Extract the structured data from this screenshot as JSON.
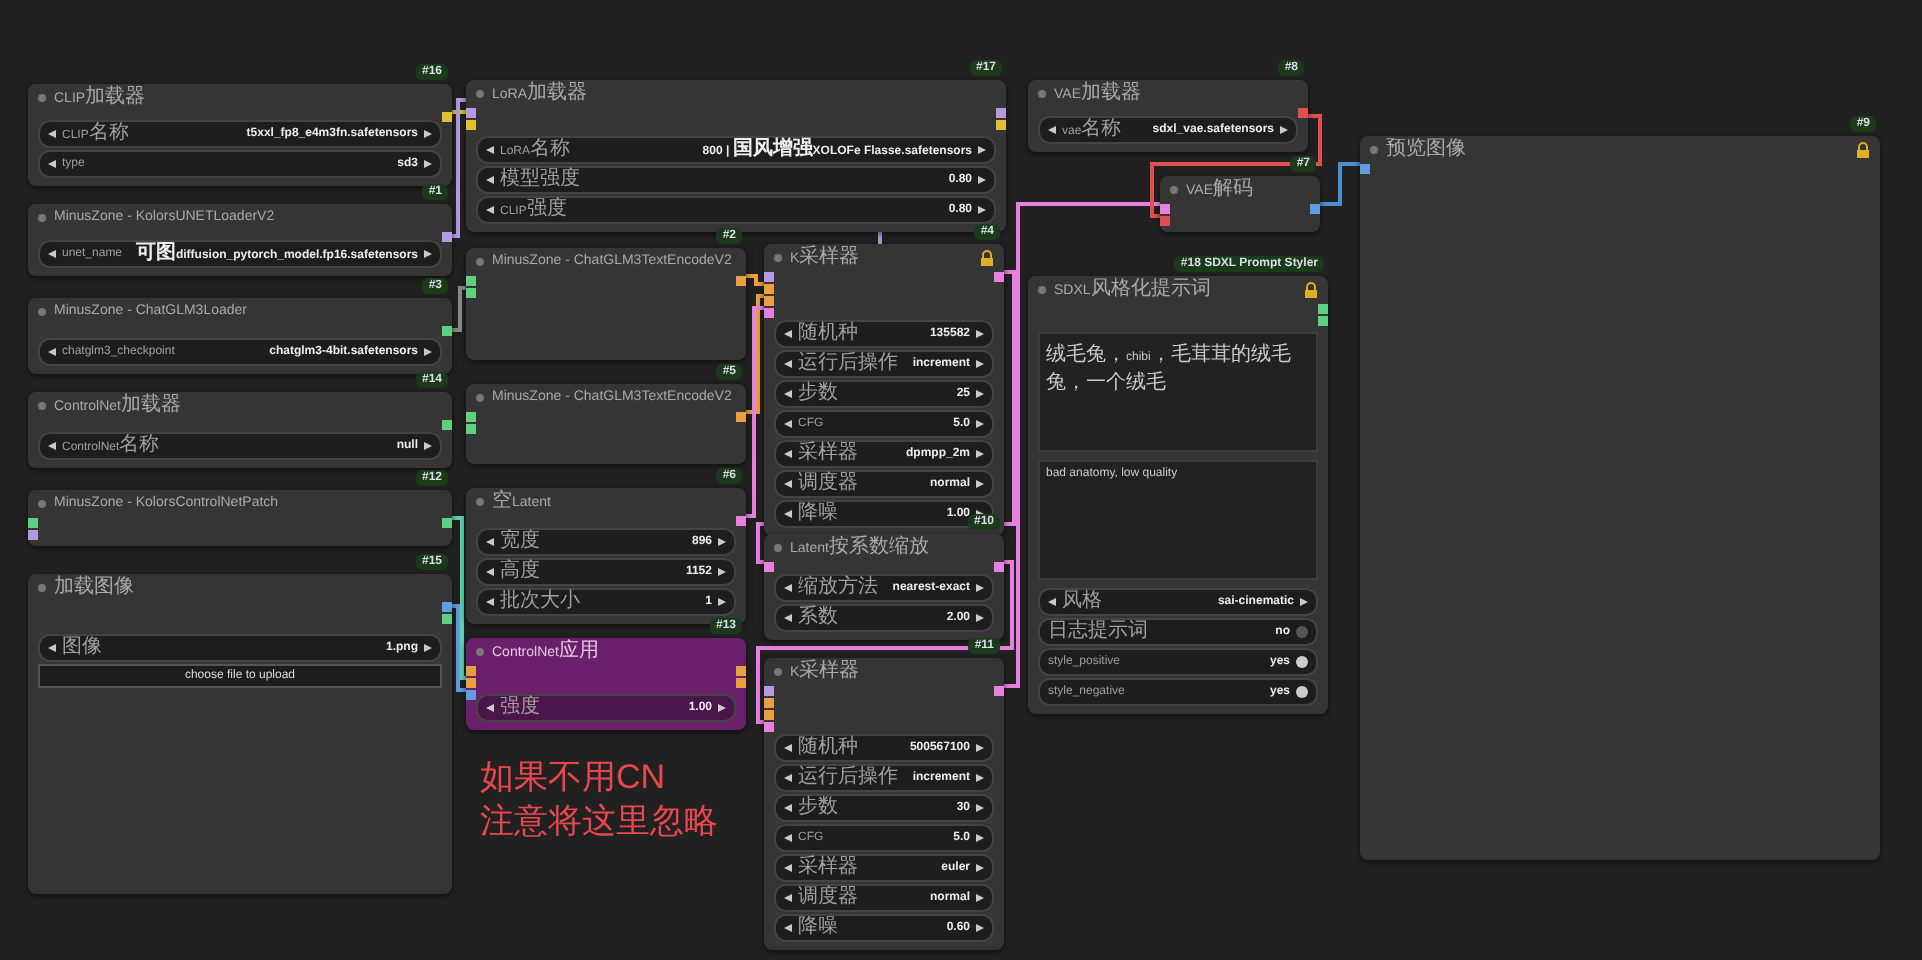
{
  "nodes": [
    {
      "badge": "#16",
      "title": "CLIP加载器",
      "bypassed": false,
      "locked": false,
      "widgets": [
        {
          "kind": "combo",
          "label": "CLIP名称",
          "value": "t5xxl_fp8_e4m3fn.safetensors"
        },
        {
          "kind": "combo",
          "label": "type",
          "value": "sd3"
        }
      ]
    },
    {
      "badge": "#1",
      "title": "MinusZone - KolorsUNETLoaderV2",
      "bypassed": false,
      "locked": false,
      "widgets": [
        {
          "kind": "combo",
          "label": "unet_name",
          "value": "可图diffusion_pytorch_model.fp16.safetensors"
        }
      ]
    },
    {
      "badge": "#3",
      "title": "MinusZone - ChatGLM3Loader",
      "bypassed": false,
      "locked": false,
      "widgets": [
        {
          "kind": "combo",
          "label": "chatglm3_checkpoint",
          "value": "chatglm3-4bit.safetensors"
        }
      ]
    },
    {
      "badge": "#14",
      "title": "ControlNet加载器",
      "bypassed": false,
      "locked": false,
      "widgets": [
        {
          "kind": "combo",
          "label": "ControlNet名称",
          "value": "null"
        }
      ]
    },
    {
      "badge": "#12",
      "title": "MinusZone - KolorsControlNetPatch",
      "bypassed": false,
      "locked": false
    },
    {
      "badge": "#15",
      "title": "加载图像",
      "bypassed": false,
      "locked": false,
      "widgets": [
        {
          "kind": "combo",
          "label": "图像",
          "value": "1.png"
        },
        {
          "kind": "button",
          "label": "choose file to upload"
        }
      ]
    },
    {
      "badge": "#17",
      "title": "LoRA加载器",
      "bypassed": false,
      "locked": false,
      "widgets": [
        {
          "kind": "combo",
          "label": "LoRA名称",
          "value": "800 | 国风增强XOLOFe Flasse.safetensors"
        },
        {
          "kind": "combo",
          "label": "模型强度",
          "value": "0.80"
        },
        {
          "kind": "combo",
          "label": "CLIP强度",
          "value": "0.80"
        }
      ]
    },
    {
      "badge": "#2",
      "title": "MinusZone - ChatGLM3TextEncodeV2",
      "bypassed": false,
      "locked": false
    },
    {
      "badge": "#5",
      "title": "MinusZone - ChatGLM3TextEncodeV2",
      "bypassed": false,
      "locked": false
    },
    {
      "badge": "#6",
      "title": "空Latent",
      "bypassed": false,
      "locked": false,
      "widgets": [
        {
          "kind": "combo",
          "label": "宽度",
          "value": "896"
        },
        {
          "kind": "combo",
          "label": "高度",
          "value": "1152"
        },
        {
          "kind": "combo",
          "label": "批次大小",
          "value": "1"
        }
      ]
    },
    {
      "badge": "#13",
      "title": "ControlNet应用",
      "bypassed": true,
      "locked": false,
      "widgets": [
        {
          "kind": "combo",
          "label": "强度",
          "value": "1.00"
        }
      ]
    },
    {
      "badge": "#4",
      "title": "K采样器",
      "bypassed": false,
      "locked": true,
      "widgets": [
        {
          "kind": "combo",
          "label": "随机种",
          "value": "135582"
        },
        {
          "kind": "combo",
          "label": "运行后操作",
          "value": "increment"
        },
        {
          "kind": "combo",
          "label": "步数",
          "value": "25"
        },
        {
          "kind": "combo",
          "label": "CFG",
          "value": "5.0"
        },
        {
          "kind": "combo",
          "label": "采样器",
          "value": "dpmpp_2m"
        },
        {
          "kind": "combo",
          "label": "调度器",
          "value": "normal"
        },
        {
          "kind": "combo",
          "label": "降噪",
          "value": "1.00"
        }
      ]
    },
    {
      "badge": "#10",
      "title": "Latent按系数缩放",
      "bypassed": false,
      "locked": false,
      "widgets": [
        {
          "kind": "combo",
          "label": "缩放方法",
          "value": "nearest-exact"
        },
        {
          "kind": "combo",
          "label": "系数",
          "value": "2.00"
        }
      ]
    },
    {
      "badge": "#11",
      "title": "K采样器",
      "bypassed": false,
      "locked": false,
      "widgets": [
        {
          "kind": "combo",
          "label": "随机种",
          "value": "500567100"
        },
        {
          "kind": "combo",
          "label": "运行后操作",
          "value": "increment"
        },
        {
          "kind": "combo",
          "label": "步数",
          "value": "30"
        },
        {
          "kind": "combo",
          "label": "CFG",
          "value": "5.0"
        },
        {
          "kind": "combo",
          "label": "采样器",
          "value": "euler"
        },
        {
          "kind": "combo",
          "label": "调度器",
          "value": "normal"
        },
        {
          "kind": "combo",
          "label": "降噪",
          "value": "0.60"
        }
      ]
    },
    {
      "badge": "#8",
      "title": "VAE加载器",
      "bypassed": false,
      "locked": false,
      "widgets": [
        {
          "kind": "combo",
          "label": "vae名称",
          "value": "sdxl_vae.safetensors"
        }
      ]
    },
    {
      "badge": "#7",
      "title": "VAE解码",
      "bypassed": false,
      "locked": false
    },
    {
      "badge": "#18 SDXL Prompt Styler",
      "title": "SDXL风格化提示词",
      "bypassed": false,
      "locked": true,
      "texts": [
        "绒毛兔，chibi，毛茸茸的绒毛兔，一个绒毛",
        "bad anatomy, low quality"
      ],
      "widgets": [
        {
          "kind": "combo",
          "label": "风格",
          "value": "sai-cinematic"
        },
        {
          "kind": "toggle",
          "label": "日志提示词",
          "value": "no",
          "on": false
        },
        {
          "kind": "toggle",
          "label": "style_positive",
          "value": "yes",
          "on": true
        },
        {
          "kind": "toggle",
          "label": "style_negative",
          "value": "yes",
          "on": true
        }
      ]
    },
    {
      "badge": "#9",
      "title": "预览图像",
      "bypassed": false,
      "locked": true
    }
  ],
  "annotation": {
    "lines": [
      "如果不用CN",
      "注意将这里忽略"
    ]
  }
}
